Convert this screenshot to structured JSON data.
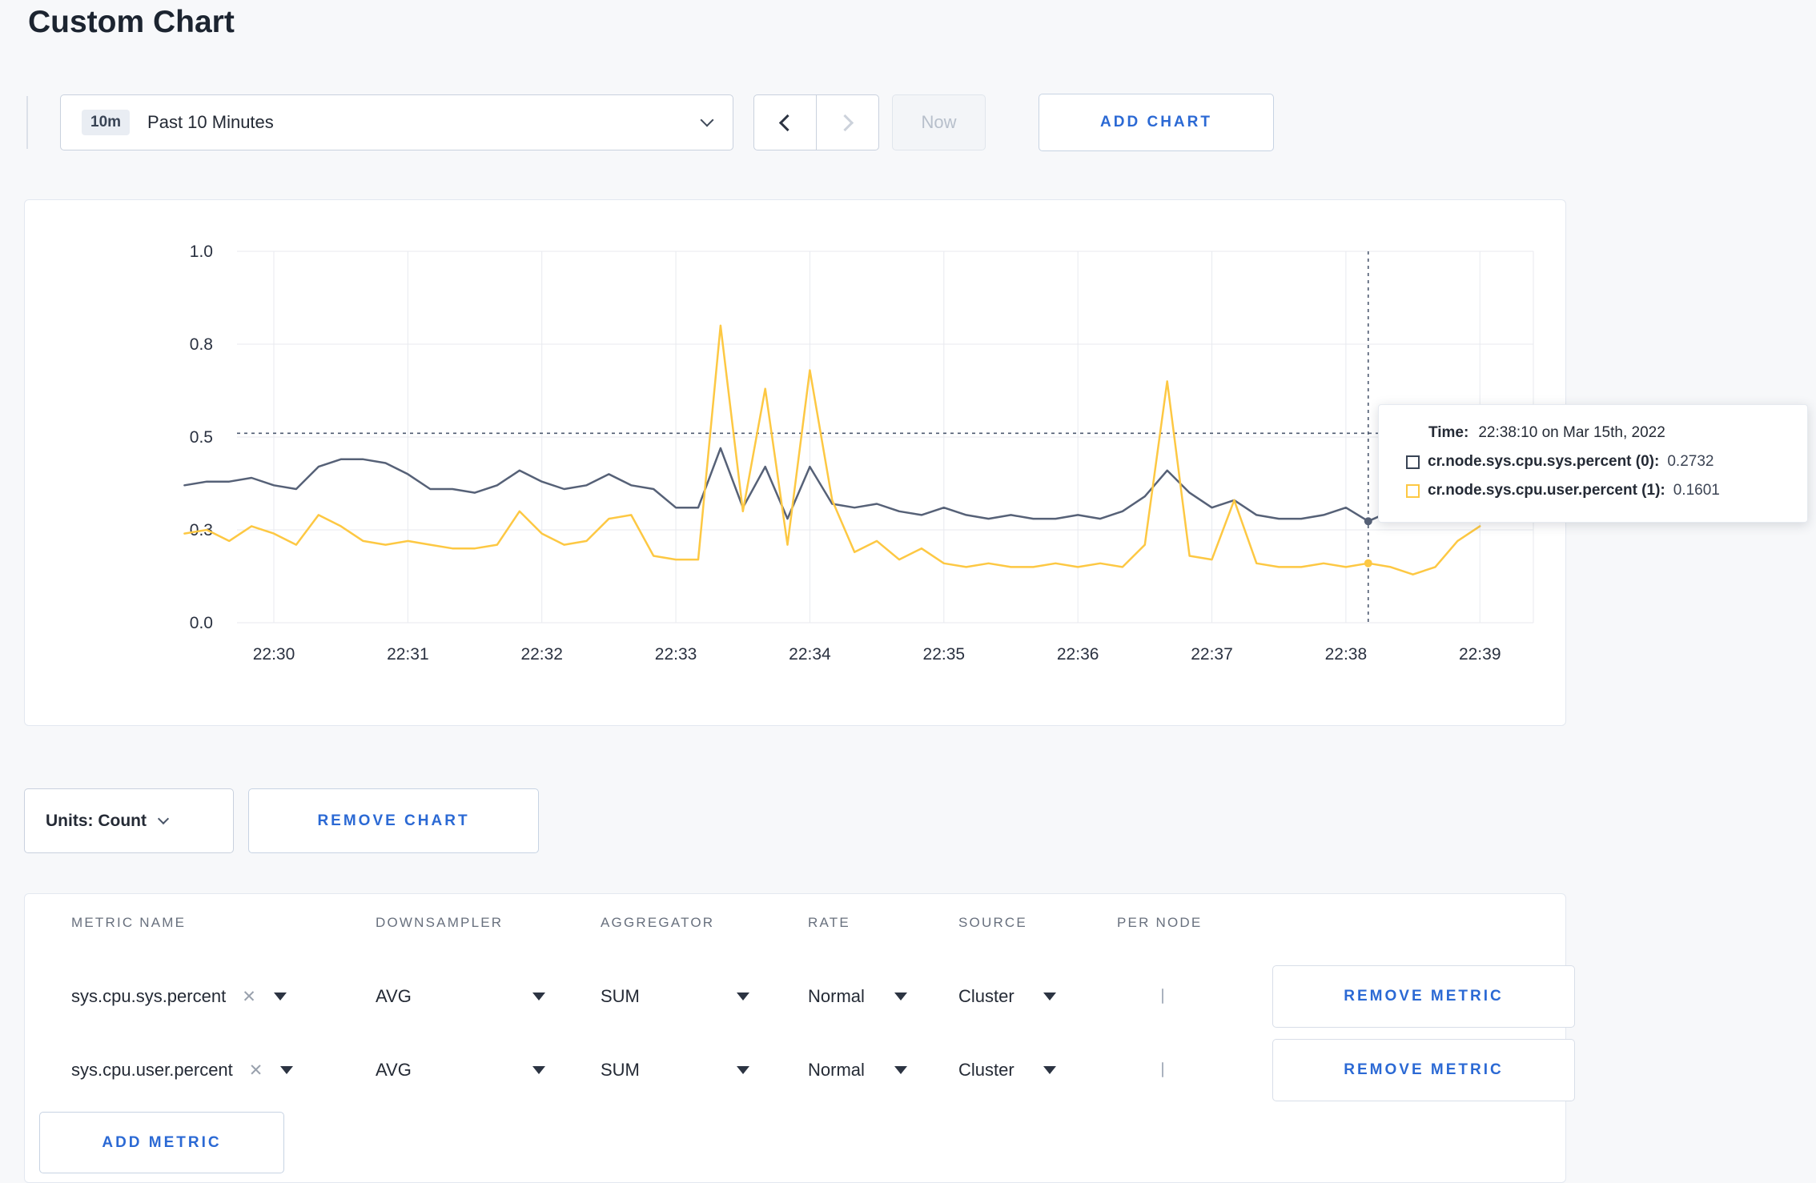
{
  "page": {
    "title": "Custom Chart"
  },
  "colors": {
    "accent": "#2b69d4",
    "series_sys": "#566177",
    "series_user": "#fdc843",
    "crosshair": "#4d5a70"
  },
  "toolbar": {
    "range_badge": "10m",
    "range_label": "Past 10 Minutes",
    "now_label": "Now",
    "add_chart_label": "ADD CHART"
  },
  "chart_controls": {
    "units_label": "Units: Count",
    "remove_chart_label": "REMOVE CHART"
  },
  "tooltip": {
    "time_label": "Time:",
    "time_value": "22:38:10 on Mar 15th, 2022",
    "series": [
      {
        "name": "cr.node.sys.cpu.sys.percent (0):",
        "value": "0.2732",
        "swatch_color": "#394455"
      },
      {
        "name": "cr.node.sys.cpu.user.percent (1):",
        "value": "0.1601",
        "swatch_color": "#fdc843"
      }
    ]
  },
  "chart_data": {
    "type": "line",
    "title": "",
    "xlabel": "",
    "ylabel": "",
    "ylim": [
      0,
      1
    ],
    "grid": true,
    "x_tick_labels": [
      "22:30",
      "22:31",
      "22:32",
      "22:33",
      "22:34",
      "22:35",
      "22:36",
      "22:37",
      "22:38",
      "22:39"
    ],
    "y_ticks": [
      0,
      0.25,
      0.5,
      0.75,
      1.0
    ],
    "y_tick_labels": [
      "0.0",
      "0.3",
      "0.5",
      "0.8",
      "1.0"
    ],
    "points_per_tick": 6,
    "first_tick_point_index": 4,
    "crosshair": {
      "point_index": 53,
      "time": "22:38:10",
      "hline_value": 0.51
    },
    "series": [
      {
        "name": "cr.node.sys.cpu.sys.percent",
        "color": "#566177",
        "values": [
          0.37,
          0.38,
          0.38,
          0.39,
          0.37,
          0.36,
          0.42,
          0.44,
          0.44,
          0.43,
          0.4,
          0.36,
          0.36,
          0.35,
          0.37,
          0.41,
          0.38,
          0.36,
          0.37,
          0.4,
          0.37,
          0.36,
          0.31,
          0.31,
          0.47,
          0.31,
          0.42,
          0.28,
          0.42,
          0.32,
          0.31,
          0.32,
          0.3,
          0.29,
          0.31,
          0.29,
          0.28,
          0.29,
          0.28,
          0.28,
          0.29,
          0.28,
          0.3,
          0.34,
          0.41,
          0.35,
          0.31,
          0.33,
          0.29,
          0.28,
          0.28,
          0.29,
          0.31,
          0.2732,
          0.3,
          0.3,
          0.32,
          0.3,
          0.31
        ]
      },
      {
        "name": "cr.node.sys.cpu.user.percent",
        "color": "#fdc843",
        "values": [
          0.24,
          0.25,
          0.22,
          0.26,
          0.24,
          0.21,
          0.29,
          0.26,
          0.22,
          0.21,
          0.22,
          0.21,
          0.2,
          0.2,
          0.21,
          0.3,
          0.24,
          0.21,
          0.22,
          0.28,
          0.29,
          0.18,
          0.17,
          0.17,
          0.8,
          0.3,
          0.63,
          0.21,
          0.68,
          0.33,
          0.19,
          0.22,
          0.17,
          0.2,
          0.16,
          0.15,
          0.16,
          0.15,
          0.15,
          0.16,
          0.15,
          0.16,
          0.15,
          0.21,
          0.65,
          0.18,
          0.17,
          0.33,
          0.16,
          0.15,
          0.15,
          0.16,
          0.15,
          0.1601,
          0.15,
          0.13,
          0.15,
          0.22,
          0.26
        ]
      }
    ]
  },
  "metrics_table": {
    "headers": [
      "METRIC NAME",
      "DOWNSAMPLER",
      "AGGREGATOR",
      "RATE",
      "SOURCE",
      "PER NODE"
    ],
    "rows": [
      {
        "metric": "sys.cpu.sys.percent",
        "downsampler": "AVG",
        "aggregator": "SUM",
        "rate": "Normal",
        "source": "Cluster",
        "per_node_checked": false,
        "remove_label": "REMOVE METRIC"
      },
      {
        "metric": "sys.cpu.user.percent",
        "downsampler": "AVG",
        "aggregator": "SUM",
        "rate": "Normal",
        "source": "Cluster",
        "per_node_checked": false,
        "remove_label": "REMOVE METRIC"
      }
    ],
    "add_metric_label": "ADD METRIC"
  }
}
